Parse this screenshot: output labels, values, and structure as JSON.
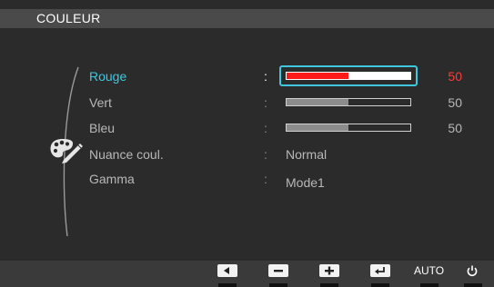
{
  "window": {
    "title": "COULEUR"
  },
  "menu": {
    "items": [
      {
        "label": "Rouge",
        "type": "slider",
        "value": 50,
        "selected": true,
        "color": "#ff1a1a"
      },
      {
        "label": "Vert",
        "type": "slider",
        "value": 50,
        "selected": false
      },
      {
        "label": "Bleu",
        "type": "slider",
        "value": 50,
        "selected": false
      },
      {
        "label": "Nuance coul.",
        "type": "option",
        "value_text": "Normal",
        "selected": false
      },
      {
        "label": "Gamma",
        "type": "option",
        "value_text": "Mode1",
        "selected": false
      }
    ],
    "separator": ":"
  },
  "category_icon": "palette-icon",
  "accent_color": "#3ec7df",
  "bottom_buttons": {
    "left": "left-arrow-icon",
    "minus": "minus-icon",
    "plus": "plus-icon",
    "enter": "enter-icon",
    "auto_label": "AUTO",
    "power": "power-icon"
  }
}
